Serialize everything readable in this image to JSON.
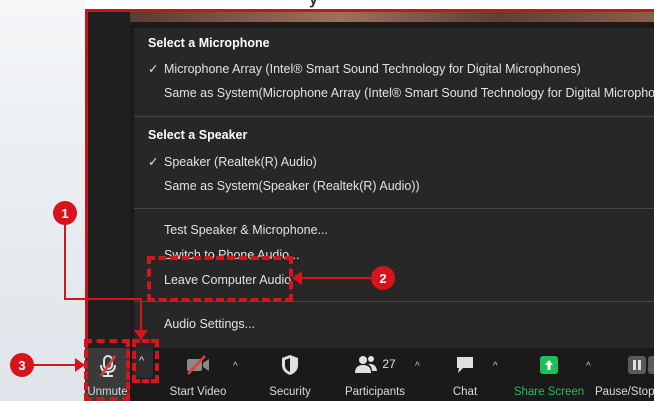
{
  "menu": {
    "microphone_title": "Select a Microphone",
    "mic_option_1": "Microphone Array (Intel® Smart Sound Technology for Digital Microphones)",
    "mic_option_2": "Same as System(Microphone Array (Intel® Smart Sound Technology for Digital Microphones))",
    "speaker_title": "Select a Speaker",
    "speaker_option_1": "Speaker (Realtek(R) Audio)",
    "speaker_option_2": "Same as System(Speaker (Realtek(R) Audio))",
    "test_speaker_mic": "Test Speaker & Microphone...",
    "switch_phone_audio": "Switch to Phone Audio...",
    "leave_computer_audio": "Leave Computer Audio",
    "audio_settings": "Audio Settings...",
    "check_mark": "✓"
  },
  "toolbar": {
    "unmute_label": "Unmute",
    "start_video_label": "Start Video",
    "security_label": "Security",
    "participants_label": "Participants",
    "participants_count": "27",
    "chat_label": "Chat",
    "share_screen_label": "Share Screen",
    "pause_stop_label": "Pause/Stop R",
    "caret": "^"
  },
  "annotations": {
    "step_1": "1",
    "step_2": "2",
    "step_3": "3"
  },
  "colors": {
    "annotation_red": "#d6141c",
    "share_green": "#1fbf5a",
    "menu_bg": "#272727",
    "toolbar_bg": "#1a1a1a"
  }
}
